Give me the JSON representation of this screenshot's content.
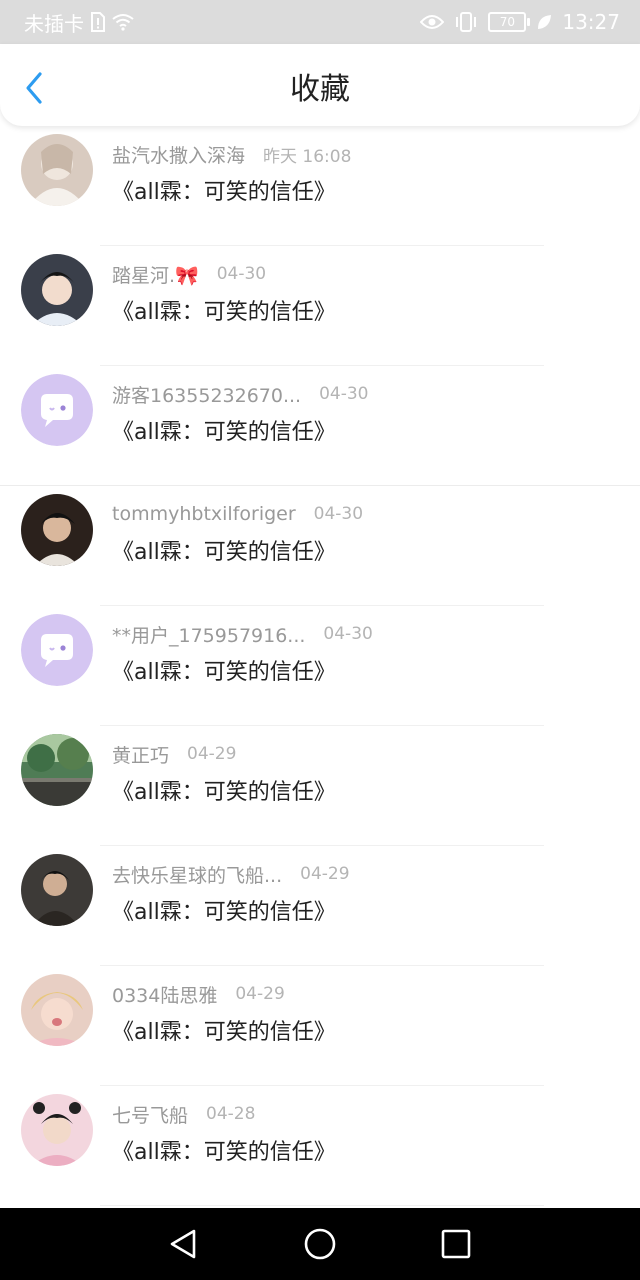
{
  "status_bar": {
    "carrier": "未插卡",
    "battery": "70",
    "time": "13:27"
  },
  "header": {
    "title": "收藏"
  },
  "items": [
    {
      "name": "盐汽水撒入深海",
      "time": "昨天 16:08",
      "content": "《all霖：可笑的信任》",
      "avatar": "photo"
    },
    {
      "name": "踏星河.🎀",
      "time": "04-30",
      "content": "《all霖：可笑的信任》",
      "avatar": "photo"
    },
    {
      "name": "游客16355232670...",
      "time": "04-30",
      "content": "《all霖：可笑的信任》",
      "avatar": "default-chat-avatar"
    },
    {
      "name": "tommyhbtxilforiger",
      "time": "04-30",
      "content": "《all霖：可笑的信任》",
      "avatar": "photo"
    },
    {
      "name": "**用户_175957916...",
      "time": "04-30",
      "content": "《all霖：可笑的信任》",
      "avatar": "default-chat-avatar"
    },
    {
      "name": "黄正巧",
      "time": "04-29",
      "content": "《all霖：可笑的信任》",
      "avatar": "photo"
    },
    {
      "name": "去快乐星球的飞船...",
      "time": "04-29",
      "content": "《all霖：可笑的信任》",
      "avatar": "photo"
    },
    {
      "name": "0334陆思雅",
      "time": "04-29",
      "content": "《all霖：可笑的信任》",
      "avatar": "photo"
    },
    {
      "name": "七号飞船",
      "time": "04-28",
      "content": "《all霖：可笑的信任》",
      "avatar": "photo"
    }
  ],
  "colors": {
    "accent": "#2d9cf0",
    "default_avatar": "#d5c6f2"
  }
}
